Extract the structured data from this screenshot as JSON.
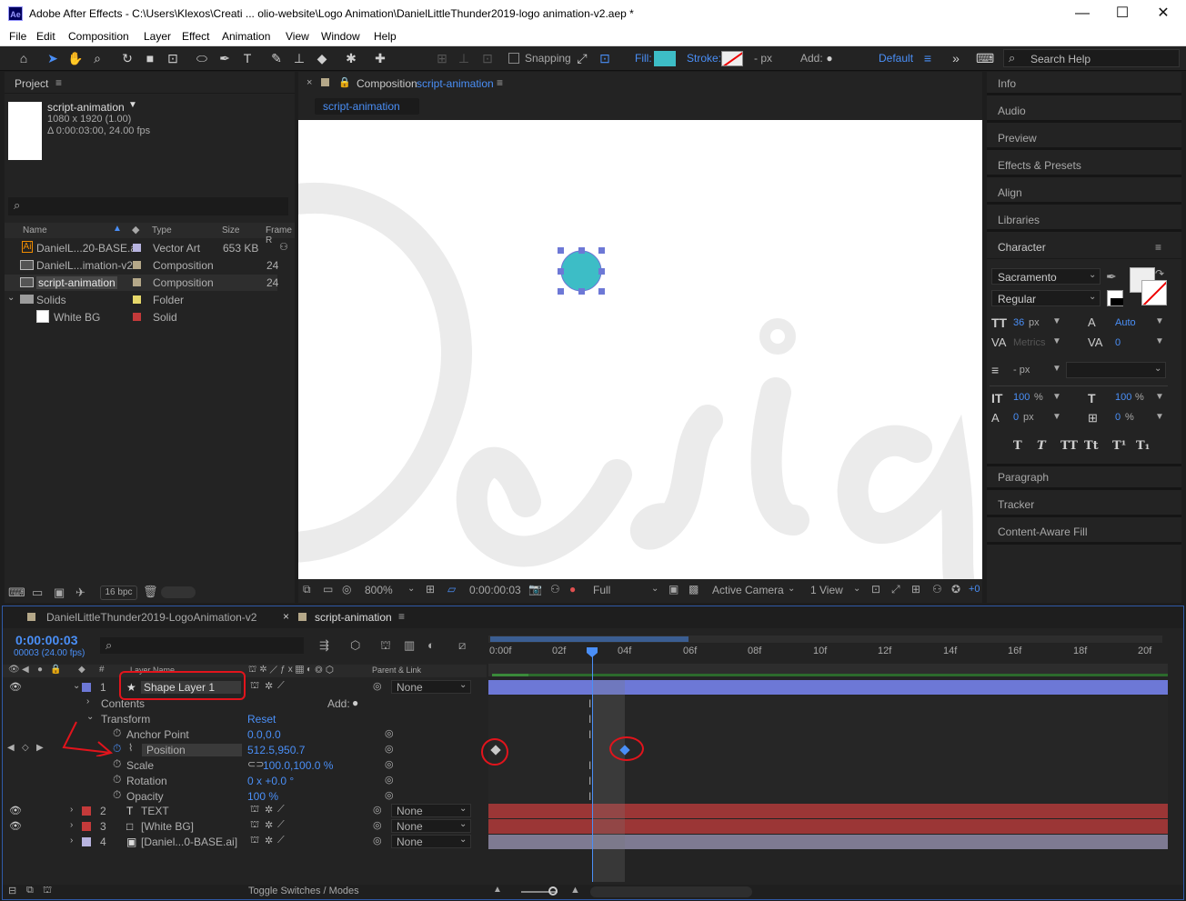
{
  "window": {
    "title": "Adobe After Effects - C:\\Users\\Klexos\\Creati ... olio-website\\Logo Animation\\DanielLittleThunder2019-logo animation-v2.aep *",
    "logo": "Ae"
  },
  "menu": [
    "File",
    "Edit",
    "Composition",
    "Layer",
    "Effect",
    "Animation",
    "View",
    "Window",
    "Help"
  ],
  "toolbar": {
    "snapping": "Snapping",
    "fill": "Fill:",
    "stroke": "Stroke:",
    "stroke_width": "- px",
    "add": "Add:",
    "workspace": "Default",
    "search_placeholder": "Search Help",
    "fill_color": "#3dbdc6"
  },
  "project": {
    "panel_title": "Project",
    "comp_name": "script-animation",
    "comp_res": "1080 x 1920 (1.00)",
    "comp_dur": "Δ 0:00:03:00, 24.00 fps",
    "columns": [
      "Name",
      "Type",
      "Size",
      "Frame R"
    ],
    "items": [
      {
        "name": "DanielL...20-BASE.ai",
        "type": "Vector Art",
        "size": "653 KB",
        "fr": "",
        "color": "#b8b4e0",
        "icon": "ai"
      },
      {
        "name": "DanielL...imation-v2",
        "type": "Composition",
        "size": "",
        "fr": "24",
        "color": "#b5a889",
        "icon": "comp"
      },
      {
        "name": "script-animation",
        "type": "Composition",
        "size": "",
        "fr": "24",
        "color": "#b5a889",
        "icon": "comp"
      },
      {
        "name": "Solids",
        "type": "Folder",
        "size": "",
        "fr": "",
        "color": "#e6d86a",
        "icon": "folder"
      },
      {
        "name": "White BG",
        "type": "Solid",
        "size": "",
        "fr": "",
        "color": "#c43a3a",
        "icon": "solid"
      }
    ],
    "bpc": "16 bpc"
  },
  "composition": {
    "panel_label": "Composition",
    "comp_name": "script-animation",
    "tab": "script-animation",
    "zoom": "800%",
    "timecode": "0:00:00:03",
    "resolution": "Full",
    "camera": "Active Camera",
    "view": "1 View",
    "exposure": "+0"
  },
  "right_panels": [
    "Info",
    "Audio",
    "Preview",
    "Effects & Presets",
    "Align",
    "Libraries"
  ],
  "character": {
    "title": "Character",
    "font": "Sacramento",
    "style": "Regular",
    "size": "36",
    "size_unit": "px",
    "leading": "Auto",
    "kerning": "Metrics",
    "tracking": "0",
    "stroke_width": "- px",
    "vscale": "100",
    "hscale": "100",
    "pct": "%",
    "baseline": "0",
    "baseline_unit": "px",
    "tsume": "0",
    "styles": [
      "T",
      "T",
      "TT",
      "Tt",
      "T¹",
      "T₁"
    ]
  },
  "lower_panels": [
    "Paragraph",
    "Tracker",
    "Content-Aware Fill"
  ],
  "timeline": {
    "tabs": [
      "DanielLittleThunder2019-LogoAnimation-v2",
      "script-animation"
    ],
    "timecode": "0:00:00:03",
    "frame_info": "00003 (24.00 fps)",
    "col_layer_name": "Layer Name",
    "col_parent": "Parent & Link",
    "ruler": [
      "0:00f",
      "02f",
      "04f",
      "06f",
      "08f",
      "10f",
      "12f",
      "14f",
      "16f",
      "18f",
      "20f"
    ],
    "layers": [
      {
        "num": "1",
        "name": "Shape Layer 1",
        "label": "#6d78d6",
        "parent": "None",
        "icon": "★"
      },
      {
        "num": "2",
        "name": "TEXT",
        "label": "#c43a3a",
        "parent": "None",
        "icon": "T"
      },
      {
        "num": "3",
        "name": "[White BG]",
        "label": "#c43a3a",
        "parent": "None",
        "icon": "□"
      },
      {
        "num": "4",
        "name": "[Daniel...0-BASE.ai]",
        "label": "#b8b4e0",
        "parent": "None",
        "icon": "ai"
      }
    ],
    "contents": "Contents",
    "add": "Add:",
    "transform": "Transform",
    "reset": "Reset",
    "props": [
      {
        "name": "Anchor Point",
        "value": "0.0,0.0"
      },
      {
        "name": "Position",
        "value": "512.5,950.7"
      },
      {
        "name": "Scale",
        "value": "100.0,100.0 %"
      },
      {
        "name": "Rotation",
        "value": "0 x +0.0 °"
      },
      {
        "name": "Opacity",
        "value": "100 %"
      }
    ],
    "toggle": "Toggle Switches / Modes"
  }
}
